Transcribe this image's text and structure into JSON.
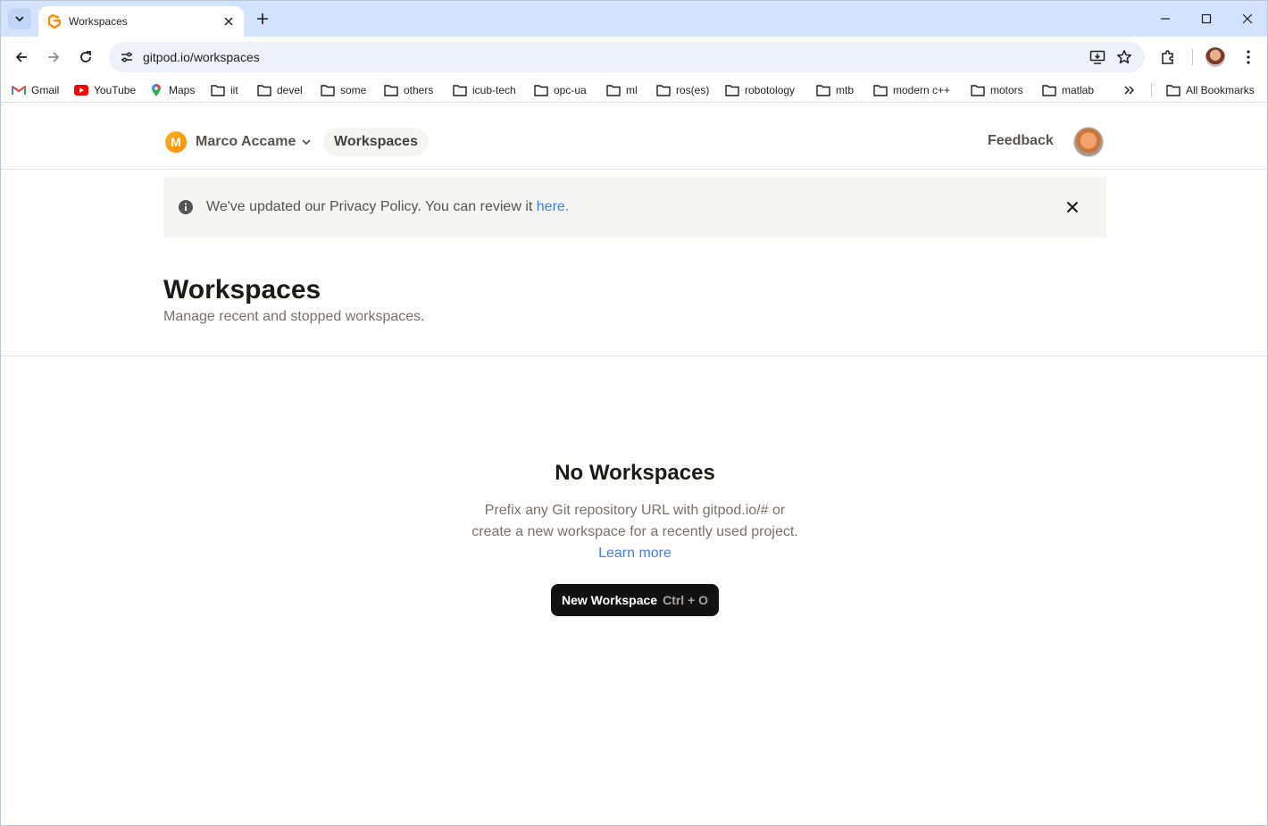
{
  "browser": {
    "tab": {
      "title": "Workspaces"
    },
    "url": "gitpod.io/workspaces",
    "bookmarks": [
      {
        "label": "Gmail",
        "icon": "gmail-icon"
      },
      {
        "label": "YouTube",
        "icon": "youtube-icon"
      },
      {
        "label": "Maps",
        "icon": "maps-icon"
      },
      {
        "label": "iit",
        "icon": "folder-icon"
      },
      {
        "label": "devel",
        "icon": "folder-icon"
      },
      {
        "label": "some",
        "icon": "folder-icon"
      },
      {
        "label": "others",
        "icon": "folder-icon"
      },
      {
        "label": "icub-tech",
        "icon": "folder-icon"
      },
      {
        "label": "opc-ua",
        "icon": "folder-icon"
      },
      {
        "label": "ml",
        "icon": "folder-icon"
      },
      {
        "label": "ros(es)",
        "icon": "folder-icon"
      },
      {
        "label": "robotology",
        "icon": "folder-icon"
      },
      {
        "label": "mtb",
        "icon": "folder-icon"
      },
      {
        "label": "modern c++",
        "icon": "folder-icon"
      },
      {
        "label": "motors",
        "icon": "folder-icon"
      },
      {
        "label": "matlab",
        "icon": "folder-icon"
      }
    ],
    "all_bookmarks": "All Bookmarks"
  },
  "header": {
    "org_initial": "M",
    "org_name": "Marco Accame",
    "nav_item": "Workspaces",
    "feedback": "Feedback"
  },
  "notice": {
    "text": "We've updated our Privacy Policy. You can review it ",
    "link": "here",
    "suffix": "."
  },
  "main": {
    "title": "Workspaces",
    "subtitle": "Manage recent and stopped workspaces."
  },
  "empty": {
    "title": "No Workspaces",
    "line1": "Prefix any Git repository URL with gitpod.io/# or",
    "line2": "create a new workspace for a recently used project.",
    "link": "Learn more",
    "button": "New Workspace",
    "shortcut": "Ctrl + O"
  },
  "colors": {
    "tab_strip": "#d3e3fd",
    "link": "#3b82f6",
    "button_bg": "#121212",
    "org_avatar": "#ff9f0a"
  }
}
